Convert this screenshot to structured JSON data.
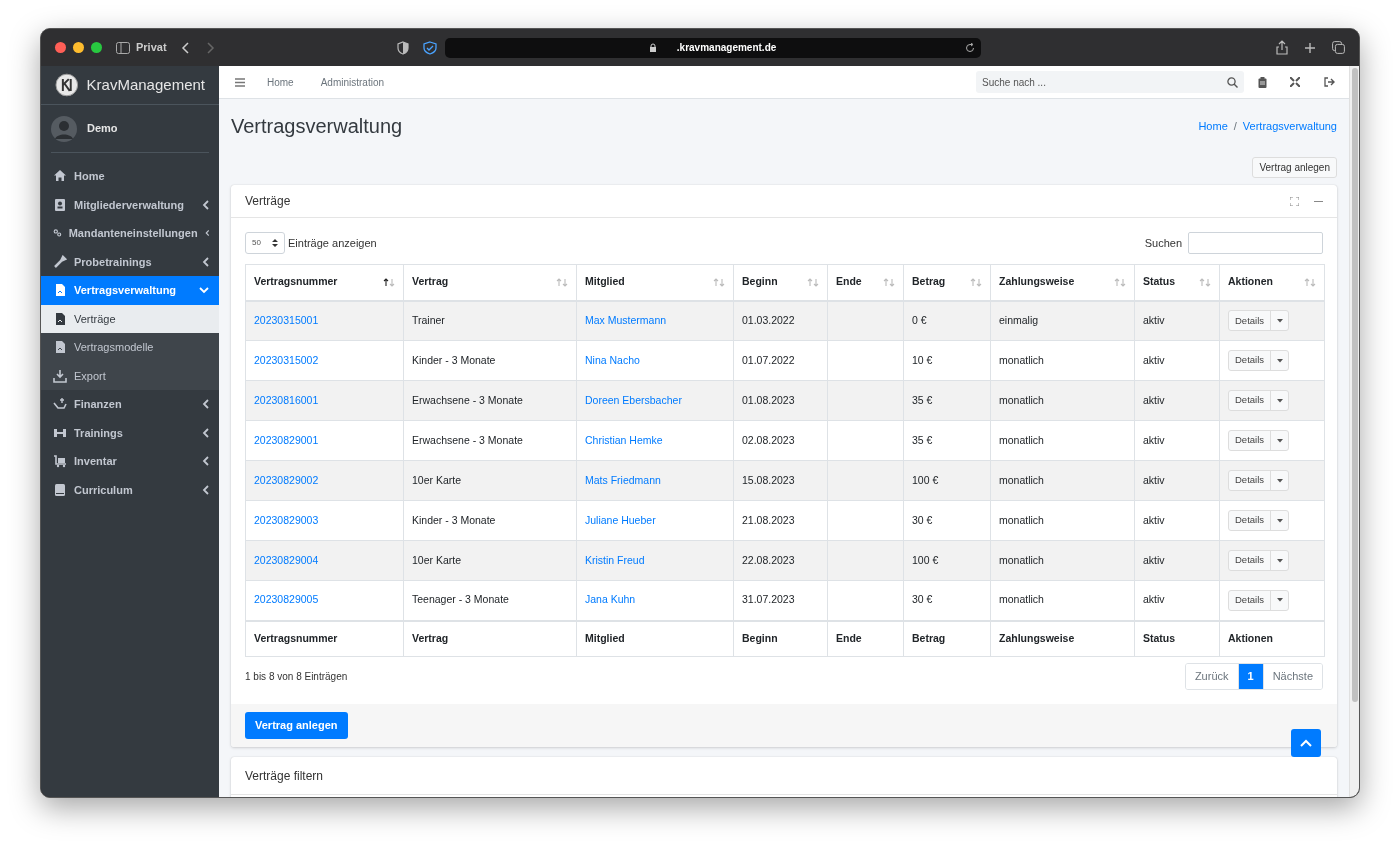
{
  "browser": {
    "profile": "Privat",
    "url": ".kravmanagement.de"
  },
  "brand": "KravManagement",
  "user": "Demo",
  "sidebar": {
    "items": [
      {
        "label": "Home",
        "selected": false
      },
      {
        "label": "Mitgliederverwaltung",
        "selected": false,
        "expanded": false
      },
      {
        "label": "Mandanteneinstellungen",
        "selected": false,
        "expanded": false
      },
      {
        "label": "Probetrainings",
        "selected": false,
        "expanded": false
      },
      {
        "label": "Vertragsverwaltung",
        "selected": true,
        "expanded": true,
        "children": [
          {
            "label": "Verträge",
            "selected": true
          },
          {
            "label": "Vertragsmodelle",
            "selected": false
          },
          {
            "label": "Export",
            "selected": false
          }
        ]
      },
      {
        "label": "Finanzen",
        "selected": false,
        "expanded": false
      },
      {
        "label": "Trainings",
        "selected": false,
        "expanded": false
      },
      {
        "label": "Inventar",
        "selected": false,
        "expanded": false
      },
      {
        "label": "Curriculum",
        "selected": false,
        "expanded": false
      }
    ]
  },
  "topnav": {
    "links": [
      "Home",
      "Administration"
    ],
    "search": {
      "placeholder": "Suche nach ..."
    }
  },
  "page_title": "Vertragsverwaltung",
  "breadcrumb": {
    "items": [
      "Home",
      "Vertragsverwaltung"
    ],
    "separator": "/"
  },
  "header_button": "Vertrag anlegen",
  "card": {
    "title": "Verträge",
    "length": {
      "value": "50",
      "label": "Einträge anzeigen"
    },
    "search_label": "Suchen",
    "table": {
      "columns": [
        {
          "label": "Vertragsnummer",
          "sorted_ascending": true
        },
        {
          "label": "Vertrag",
          "sorted_ascending": false
        },
        {
          "label": "Mitglied",
          "sorted_ascending": false
        },
        {
          "label": "Beginn",
          "sorted_ascending": false
        },
        {
          "label": "Ende",
          "sorted_ascending": false
        },
        {
          "label": "Betrag",
          "sorted_ascending": false
        },
        {
          "label": "Zahlungsweise",
          "sorted_ascending": false
        },
        {
          "label": "Status",
          "sorted_ascending": false
        },
        {
          "label": "Aktionen",
          "sorted_ascending": false
        }
      ],
      "rows": [
        {
          "number": "20230315001",
          "contract": "Trainer",
          "member": "Max Mustermann",
          "start": "01.03.2022",
          "amount": "0 €",
          "payment": "einmalig",
          "status": "aktiv",
          "action": "Details"
        },
        {
          "number": "20230315002",
          "contract": "Kinder - 3 Monate",
          "member": "Nina Nacho",
          "start": "01.07.2022",
          "amount": "10 €",
          "payment": "monatlich",
          "status": "aktiv",
          "action": "Details"
        },
        {
          "number": "20230816001",
          "contract": "Erwachsene - 3 Monate",
          "member": "Doreen Ebersbacher",
          "start": "01.08.2023",
          "amount": "35 €",
          "payment": "monatlich",
          "status": "aktiv",
          "action": "Details"
        },
        {
          "number": "20230829001",
          "contract": "Erwachsene - 3 Monate",
          "member": "Christian Hemke",
          "start": "02.08.2023",
          "amount": "35 €",
          "payment": "monatlich",
          "status": "aktiv",
          "action": "Details"
        },
        {
          "number": "20230829002",
          "contract": "10er Karte",
          "member": "Mats Friedmann",
          "start": "15.08.2023",
          "amount": "100 €",
          "payment": "monatlich",
          "status": "aktiv",
          "action": "Details"
        },
        {
          "number": "20230829003",
          "contract": "Kinder - 3 Monate",
          "member": "Juliane Hueber",
          "start": "21.08.2023",
          "amount": "30 €",
          "payment": "monatlich",
          "status": "aktiv",
          "action": "Details"
        },
        {
          "number": "20230829004",
          "contract": "10er Karte",
          "member": "Kristin Freud",
          "start": "22.08.2023",
          "amount": "100 €",
          "payment": "monatlich",
          "status": "aktiv",
          "action": "Details"
        },
        {
          "number": "20230829005",
          "contract": "Teenager - 3 Monate",
          "member": "Jana Kuhn",
          "start": "31.07.2023",
          "amount": "30 €",
          "payment": "monatlich",
          "status": "aktiv",
          "action": "Details"
        }
      ],
      "footer": [
        "Vertragsnummer",
        "Vertrag",
        "Mitglied",
        "Beginn",
        "Ende",
        "Betrag",
        "Zahlungsweise",
        "Status",
        "Aktionen"
      ]
    },
    "info": "1 bis 8 von 8 Einträgen",
    "pagination": [
      {
        "label": "Zurück",
        "selected": false
      },
      {
        "label": "1",
        "selected": true
      },
      {
        "label": "Nächste",
        "selected": false
      }
    ],
    "primary_button": "Vertrag anlegen"
  },
  "filter_card": {
    "title": "Verträge filtern"
  }
}
